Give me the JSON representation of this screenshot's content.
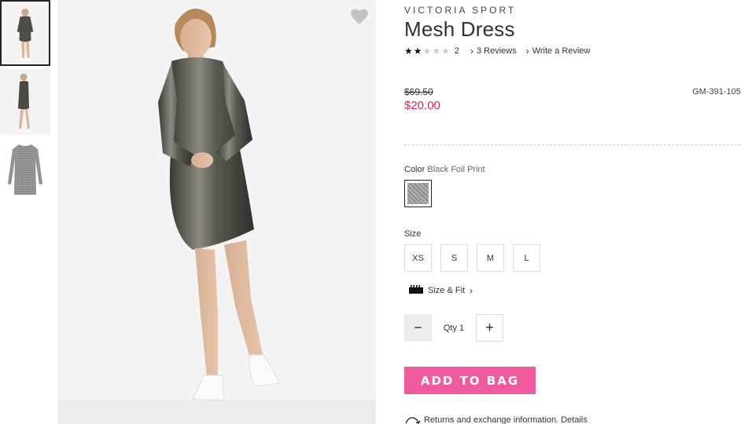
{
  "product": {
    "brand": "VICTORIA SPORT",
    "name": "Mesh Dress",
    "rating": {
      "stars_filled": 2,
      "stars_total": 5,
      "count": "2"
    },
    "reviews_link": "3 Reviews",
    "write_review_link": "Write a Review",
    "original_price": "$69.50",
    "sale_price": "$20.00",
    "sku": "GM-391-105"
  },
  "color": {
    "label": "Color",
    "selected": "Black Foil Print"
  },
  "size": {
    "label": "Size",
    "options": [
      "XS",
      "S",
      "M",
      "L"
    ],
    "size_fit_link": "Size & Fit"
  },
  "quantity": {
    "label": "Qty",
    "value": "1",
    "minus": "−",
    "plus": "+"
  },
  "actions": {
    "add_to_bag": "ADD TO BAG"
  },
  "returns": {
    "text": "Returns and exchange information.",
    "details_link": "Details"
  },
  "thumbnails": [
    "front-view",
    "side-view",
    "flat-lay"
  ],
  "colors": {
    "accent_pink": "#ef5b9c",
    "sale_red": "#d9265e"
  }
}
